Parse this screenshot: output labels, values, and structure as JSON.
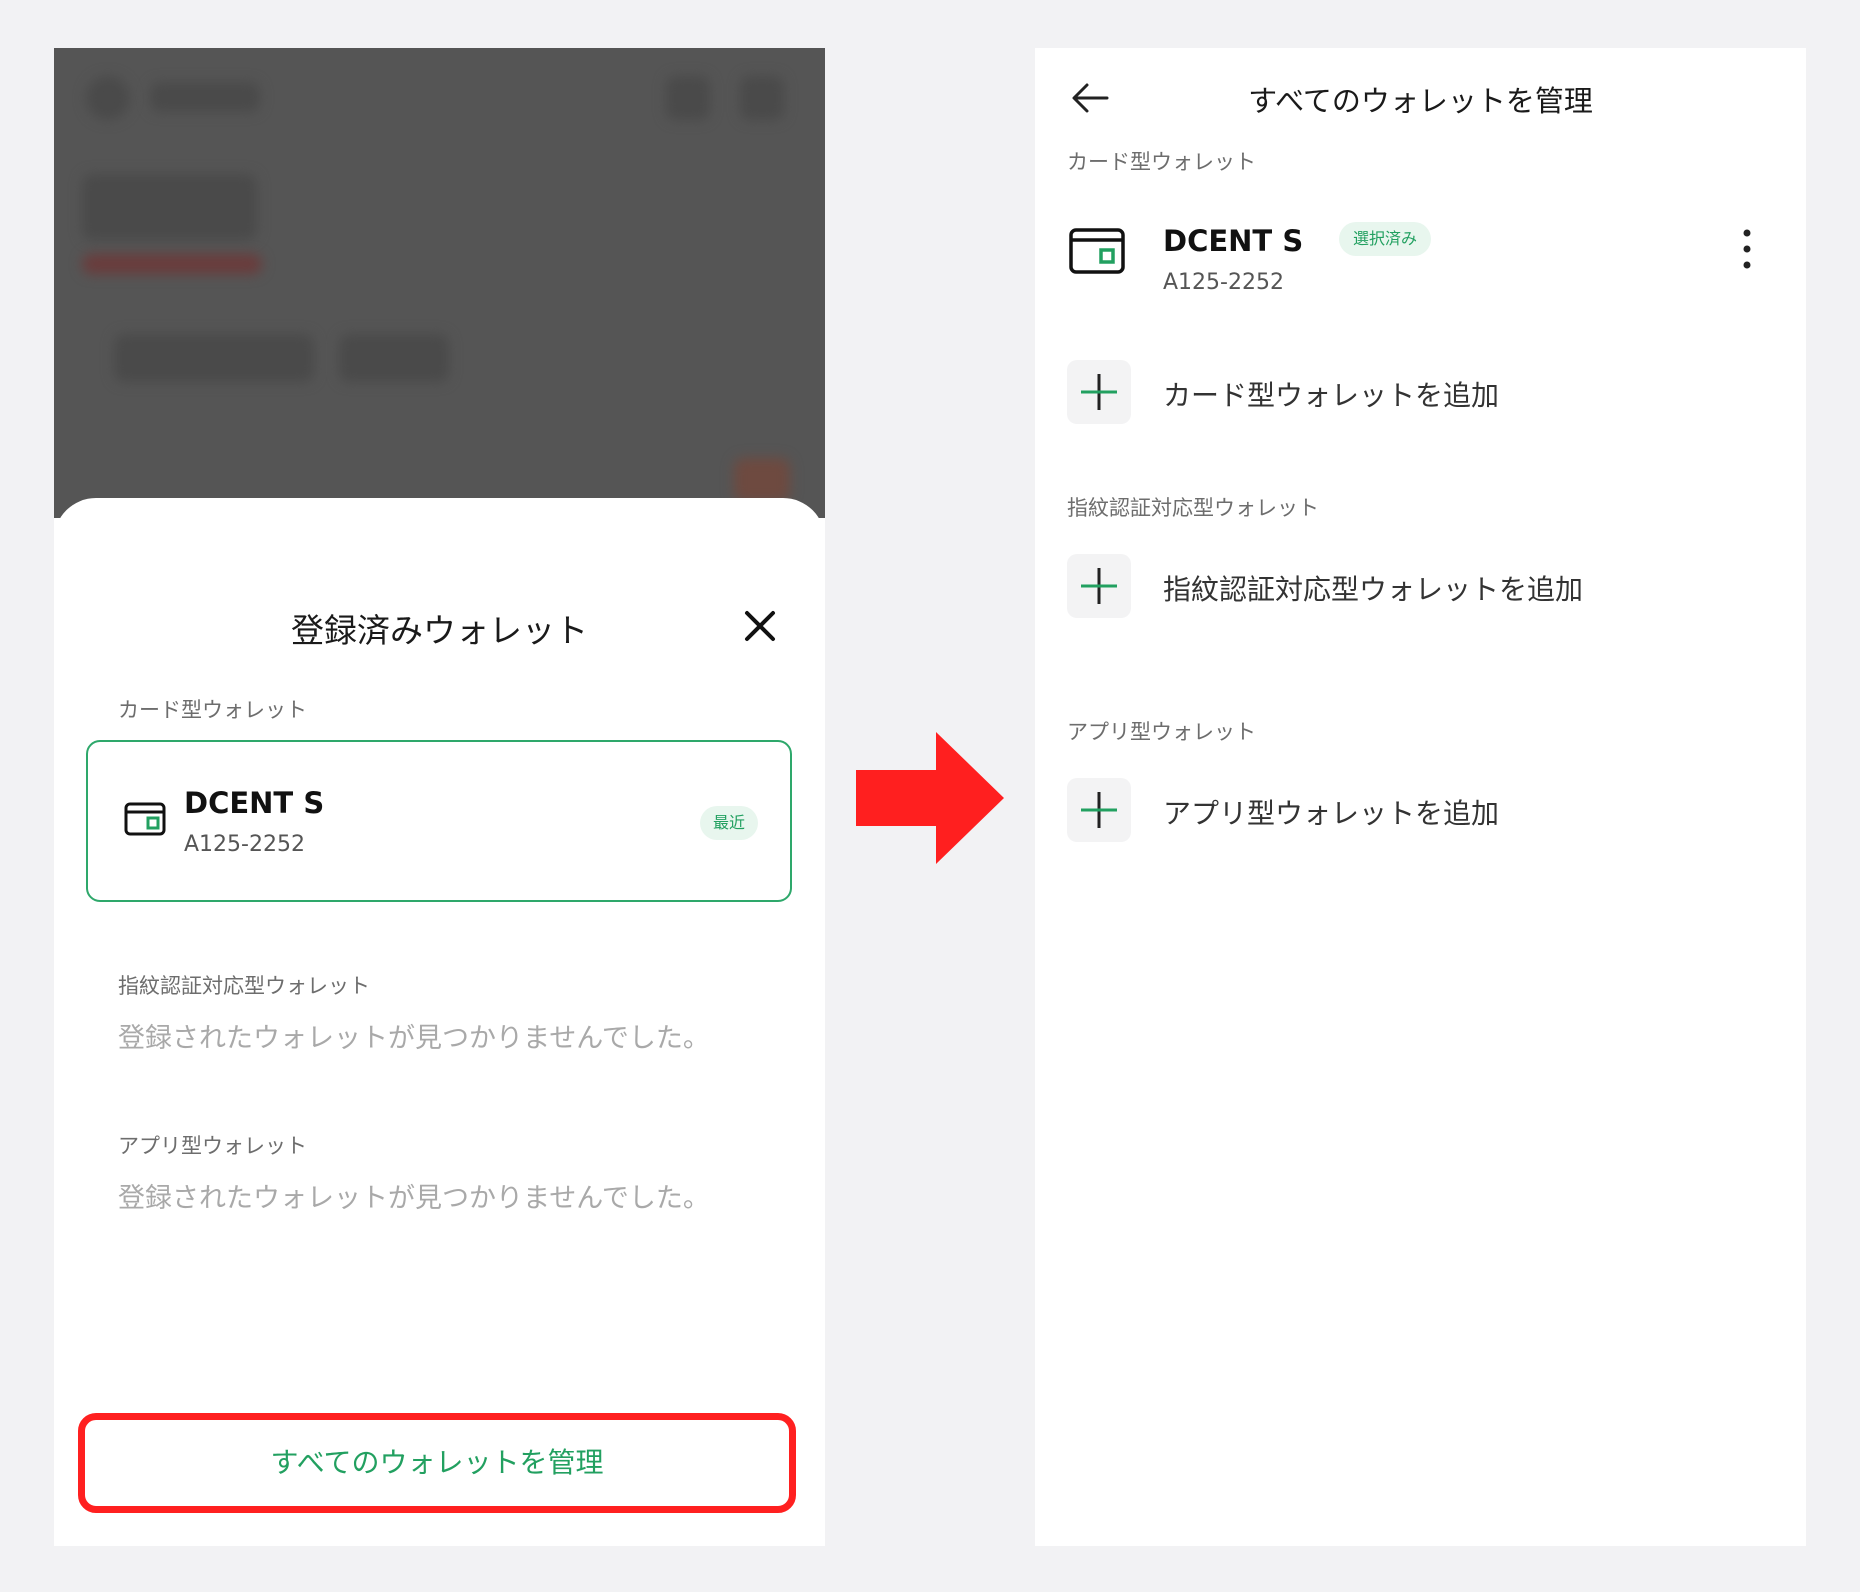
{
  "left_screen": {
    "sheet_title": "登録済みウォレット",
    "sections": {
      "card_label": "カード型ウォレット",
      "fingerprint_label": "指紋認証対応型ウォレット",
      "app_label": "アプリ型ウォレット"
    },
    "card_wallet": {
      "name": "DCENT S",
      "id": "A125-2252",
      "badge": "最近"
    },
    "empty_message": "登録されたウォレットが見つかりませんでした。",
    "manage_button": "すべてのウォレットを管理"
  },
  "right_screen": {
    "title": "すべてのウォレットを管理",
    "card_label": "カード型ウォレット",
    "card_wallet": {
      "name": "DCENT S",
      "id": "A125-2252",
      "badge": "選択済み"
    },
    "add_card": "カード型ウォレットを追加",
    "fingerprint_label": "指紋認証対応型ウォレット",
    "add_fingerprint": "指紋認証対応型ウォレットを追加",
    "app_label": "アプリ型ウォレット",
    "add_app": "アプリ型ウォレットを追加"
  },
  "colors": {
    "accent_green": "#22a060",
    "highlight_red": "#ff2020",
    "overlay_gray": "#555555"
  },
  "icons": [
    "close-icon",
    "card-wallet-icon",
    "back-arrow-icon",
    "more-vertical-icon",
    "plus-icon",
    "right-arrow-icon"
  ]
}
